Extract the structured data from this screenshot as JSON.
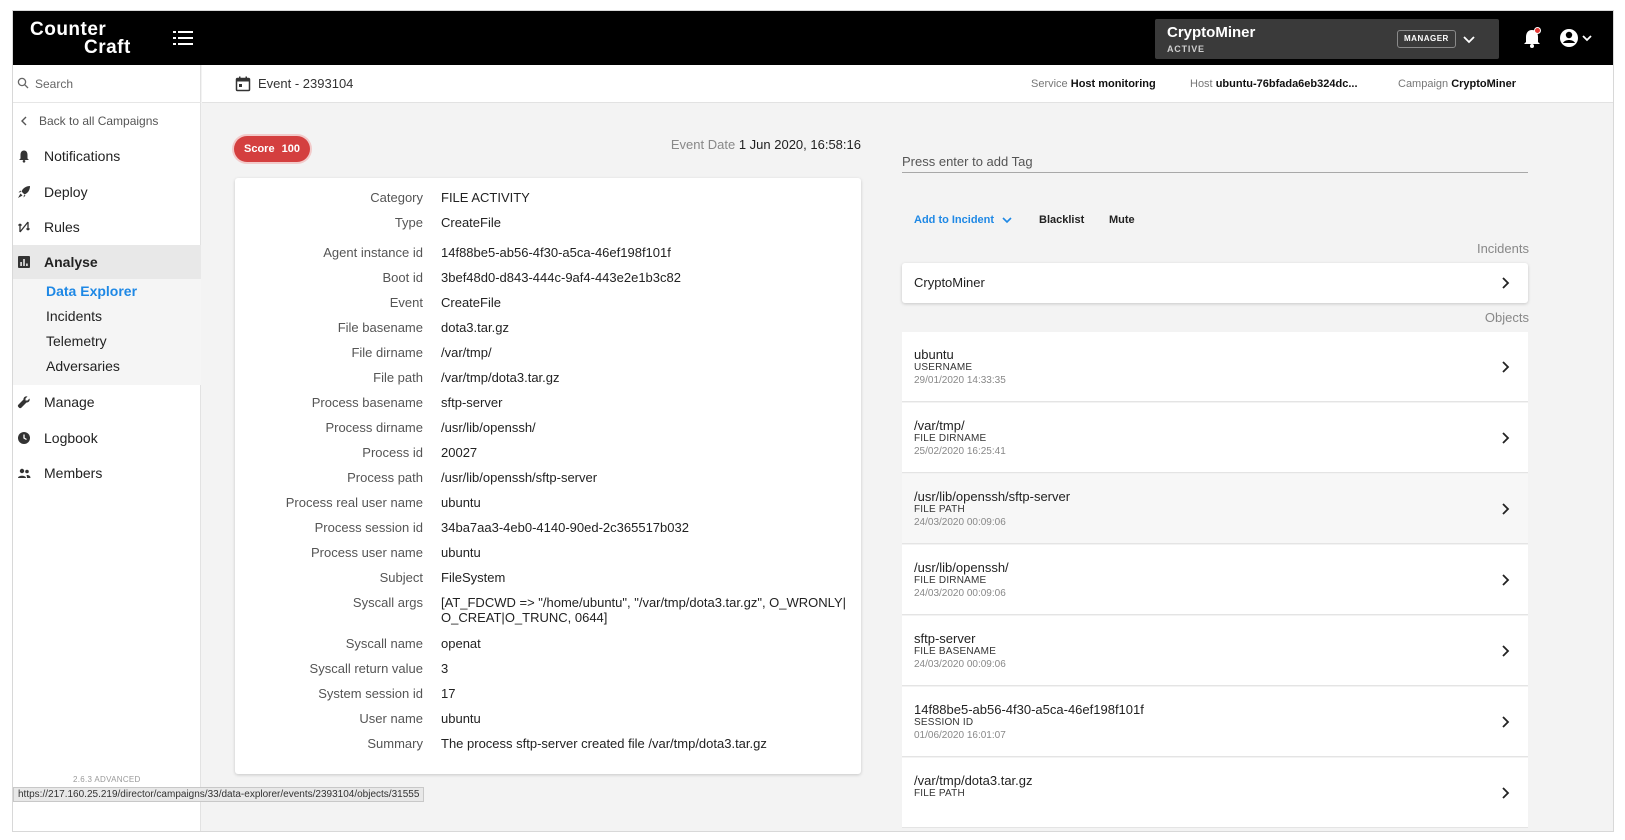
{
  "header": {
    "logo_line1": "Counter",
    "logo_line2": "Craft",
    "campaign_name": "CryptoMiner",
    "campaign_status": "ACTIVE",
    "role": "MANAGER"
  },
  "sidebar": {
    "search_placeholder": "Search",
    "back_label": "Back to all Campaigns",
    "items": [
      {
        "label": "Notifications",
        "icon": "bell-icon"
      },
      {
        "label": "Deploy",
        "icon": "rocket-icon"
      },
      {
        "label": "Rules",
        "icon": "rules-icon"
      },
      {
        "label": "Analyse",
        "icon": "bar-chart-icon"
      },
      {
        "label": "Manage",
        "icon": "wrench-icon"
      },
      {
        "label": "Logbook",
        "icon": "clock-icon"
      },
      {
        "label": "Members",
        "icon": "people-icon"
      }
    ],
    "analyse_sub": [
      "Data Explorer",
      "Incidents",
      "Telemetry",
      "Adversaries"
    ],
    "version": "2.6.3 ADVANCED"
  },
  "subheader": {
    "event_title": "Event - 2393104",
    "service_label": "Service",
    "service_value": "Host monitoring",
    "host_label": "Host",
    "host_value": "ubuntu-76bfada6eb324dc...",
    "campaign_label": "Campaign",
    "campaign_value": "CryptoMiner"
  },
  "event": {
    "score_label": "Score",
    "score_value": "100",
    "date_label": "Event Date",
    "date_value": "1 Jun 2020, 16:58:16",
    "fields": [
      {
        "key": "Category",
        "value": "FILE ACTIVITY"
      },
      {
        "key": "Type",
        "value": "CreateFile"
      },
      {
        "key": "Agent instance id",
        "value": "14f88be5-ab56-4f30-a5ca-46ef198f101f"
      },
      {
        "key": "Boot id",
        "value": "3bef48d0-d843-444c-9af4-443e2e1b3c82"
      },
      {
        "key": "Event",
        "value": "CreateFile"
      },
      {
        "key": "File basename",
        "value": "dota3.tar.gz"
      },
      {
        "key": "File dirname",
        "value": "/var/tmp/"
      },
      {
        "key": "File path",
        "value": "/var/tmp/dota3.tar.gz"
      },
      {
        "key": "Process basename",
        "value": "sftp-server"
      },
      {
        "key": "Process dirname",
        "value": "/usr/lib/openssh/"
      },
      {
        "key": "Process id",
        "value": "20027"
      },
      {
        "key": "Process path",
        "value": "/usr/lib/openssh/sftp-server"
      },
      {
        "key": "Process real user name",
        "value": "ubuntu"
      },
      {
        "key": "Process session id",
        "value": "34ba7aa3-4eb0-4140-90ed-2c365517b032"
      },
      {
        "key": "Process user name",
        "value": "ubuntu"
      },
      {
        "key": "Subject",
        "value": "FileSystem"
      },
      {
        "key": "Syscall args",
        "value": "[AT_FDCWD => \"/home/ubuntu\", \"/var/tmp/dota3.tar.gz\", O_WRONLY|O_CREAT|O_TRUNC, 0644]"
      },
      {
        "key": "Syscall name",
        "value": "openat"
      },
      {
        "key": "Syscall return value",
        "value": "3"
      },
      {
        "key": "System session id",
        "value": "17"
      },
      {
        "key": "User name",
        "value": "ubuntu"
      },
      {
        "key": "Summary",
        "value": "The process sftp-server created file /var/tmp/dota3.tar.gz"
      }
    ]
  },
  "tags": {
    "placeholder": "Press enter to add Tag"
  },
  "actions": {
    "add_to_incident": "Add to Incident",
    "blacklist": "Blacklist",
    "mute": "Mute"
  },
  "incidents": {
    "label": "Incidents",
    "items": [
      "CryptoMiner"
    ]
  },
  "objects": {
    "label": "Objects",
    "items": [
      {
        "name": "ubuntu",
        "type": "USERNAME",
        "date": "29/01/2020 14:33:35"
      },
      {
        "name": "/var/tmp/",
        "type": "FILE DIRNAME",
        "date": "25/02/2020 16:25:41"
      },
      {
        "name": "/usr/lib/openssh/sftp-server",
        "type": "FILE PATH",
        "date": "24/03/2020 00:09:06"
      },
      {
        "name": "/usr/lib/openssh/",
        "type": "FILE DIRNAME",
        "date": "24/03/2020 00:09:06"
      },
      {
        "name": "sftp-server",
        "type": "FILE BASENAME",
        "date": "24/03/2020 00:09:06"
      },
      {
        "name": "14f88be5-ab56-4f30-a5ca-46ef198f101f",
        "type": "SESSION ID",
        "date": "01/06/2020 16:01:07"
      },
      {
        "name": "/var/tmp/dota3.tar.gz",
        "type": "FILE PATH",
        "date": ""
      }
    ]
  },
  "statusbar": {
    "url": "https://217.160.25.219/director/campaigns/33/data-explorer/events/2393104/objects/31555"
  },
  "colors": {
    "accent": "#1e88e5",
    "score": "#d43f3f",
    "header": "#000000"
  }
}
